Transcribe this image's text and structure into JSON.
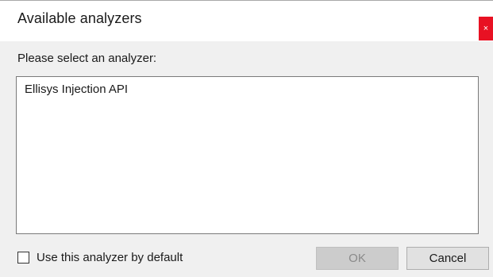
{
  "window": {
    "title": "Available analyzers",
    "close_glyph": "×"
  },
  "prompt": "Please select an analyzer:",
  "analyzers": [
    "Ellisys Injection API"
  ],
  "default_checkbox": {
    "label": "Use this analyzer by default",
    "checked": false
  },
  "buttons": {
    "ok": "OK",
    "cancel": "Cancel"
  },
  "colors": {
    "close_button": "#e81123",
    "dialog_background": "#f0f0f0"
  }
}
